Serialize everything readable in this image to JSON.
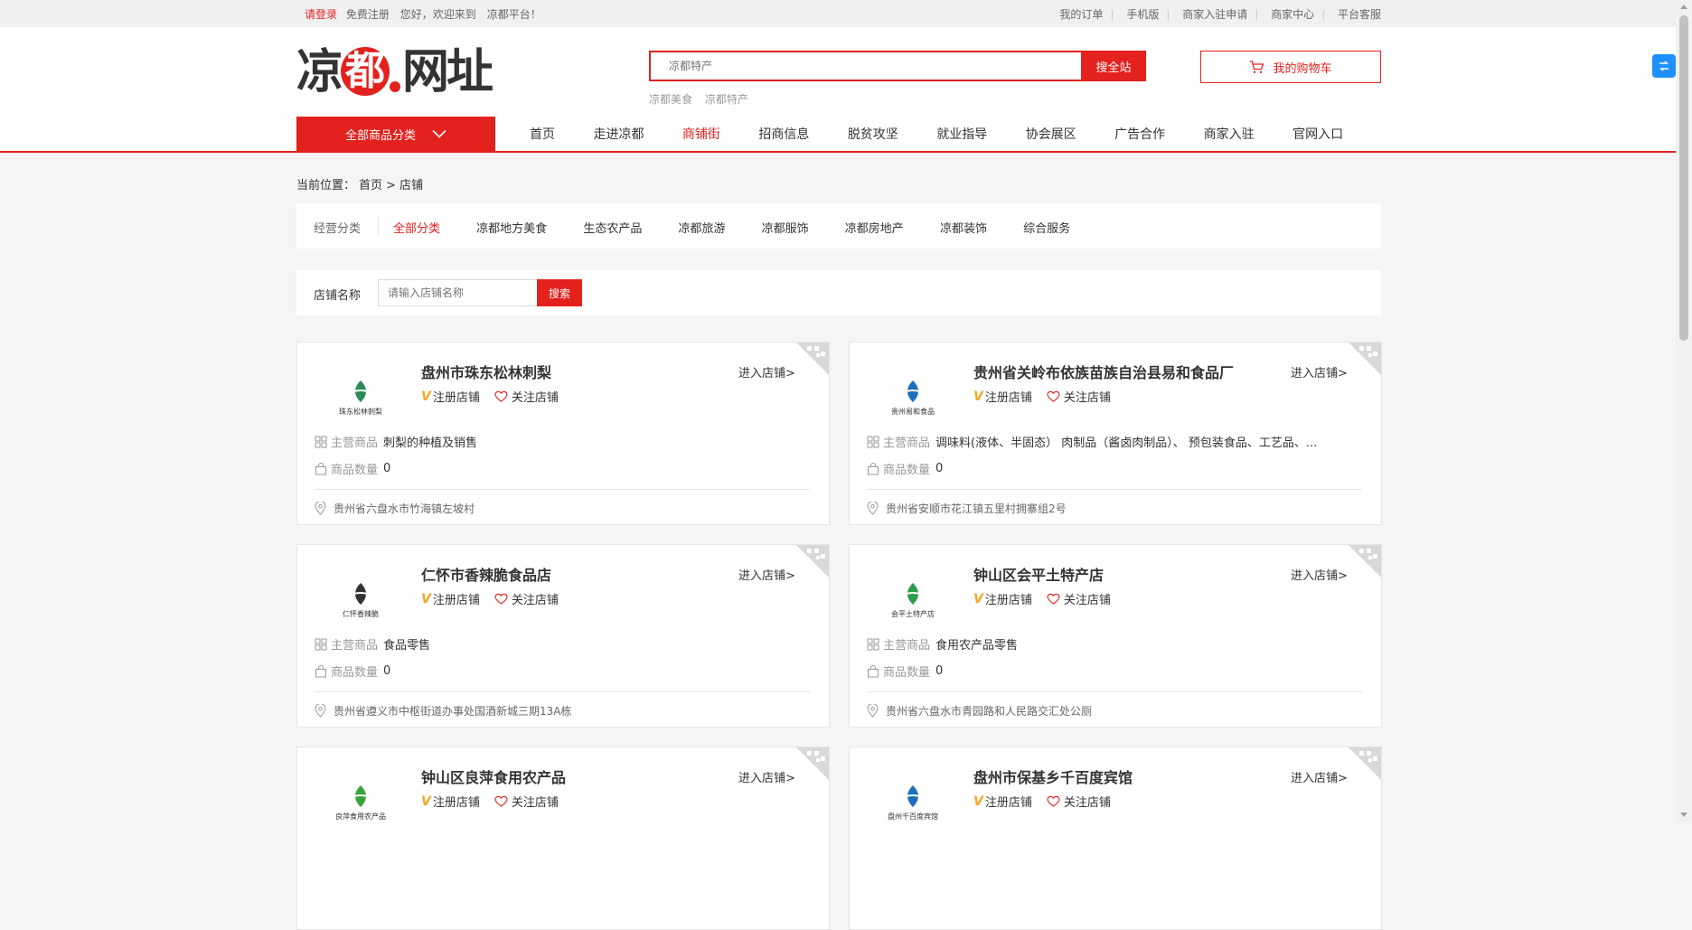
{
  "topbar": {
    "login": "请登录",
    "register": "免费注册",
    "welcome": "您好，欢迎来到　凉都平台！",
    "links": [
      "我的订单",
      "手机版",
      "商家入驻申请",
      "商家中心",
      "平台客服"
    ]
  },
  "header": {
    "logo_a": "凉",
    "logo_b": "都",
    "logo_c": "网址",
    "search_placeholder": "凉都特产",
    "search_button": "搜全站",
    "hotwords": [
      "凉都美食",
      "凉都特产"
    ],
    "cart_label": "我的购物车"
  },
  "nav": {
    "all_categories": "全部商品分类",
    "items": [
      "首页",
      "走进凉都",
      "商铺街",
      "招商信息",
      "脱贫攻坚",
      "就业指导",
      "协会展区",
      "广告合作",
      "商家入驻",
      "官网入口"
    ],
    "active_index": 2
  },
  "breadcrumb": {
    "prefix": "当前位置：",
    "home": "首页",
    "sep": ">",
    "current": "店铺"
  },
  "category_filter": {
    "label": "经营分类",
    "items": [
      "全部分类",
      "凉都地方美食",
      "生态农产品",
      "凉都旅游",
      "凉都服饰",
      "凉都房地产",
      "凉都装饰",
      "综合服务"
    ],
    "active_index": 0
  },
  "shop_search": {
    "label": "店铺名称",
    "placeholder": "请输入店铺名称",
    "button": "搜索"
  },
  "card_labels": {
    "enter": "进入店铺>",
    "registered": "注册店铺",
    "follow": "关注店铺",
    "main_products": "主营商品",
    "product_count": "商品数量"
  },
  "shops": [
    {
      "name": "盘州市珠东松林刺梨",
      "logo_caption": "珠东松林刺梨",
      "main": "刺梨的种植及销售",
      "count": "0",
      "address": "贵州省六盘水市竹海镇左坡村",
      "logo_color": "#2e8b57"
    },
    {
      "name": "贵州省关岭布依族苗族自治县易和食品厂",
      "logo_caption": "贵州易和食品",
      "main": "调味料(液体、半固态） 肉制品（酱卤肉制品）、 预包装食品、工艺品、...",
      "count": "0",
      "address": "贵州省安顺市花江镇五里村拥寨组2号",
      "logo_color": "#1e6fb8"
    },
    {
      "name": "仁怀市香辣脆食品店",
      "logo_caption": "仁怀香辣脆",
      "main": "食品零售",
      "count": "0",
      "address": "贵州省遵义市中枢街道办事处国酒新城三期13A栋",
      "logo_color": "#333333"
    },
    {
      "name": "钟山区会平土特产店",
      "logo_caption": "会平土特产店",
      "main": "食用农产品零售",
      "count": "0",
      "address": "贵州省六盘水市青园路和人民路交汇处公厕",
      "logo_color": "#2e9b4e"
    },
    {
      "name": "钟山区良萍食用农产品",
      "logo_caption": "良萍食用农产品",
      "main": "",
      "count": "",
      "address": "",
      "logo_color": "#3aa23a"
    },
    {
      "name": "盘州市保基乡千百度宾馆",
      "logo_caption": "盘州千百度宾馆",
      "main": "",
      "count": "",
      "address": "",
      "logo_color": "#1e6fb8"
    }
  ],
  "colors": {
    "accent": "#e3211d",
    "badge": "#f5a623"
  }
}
